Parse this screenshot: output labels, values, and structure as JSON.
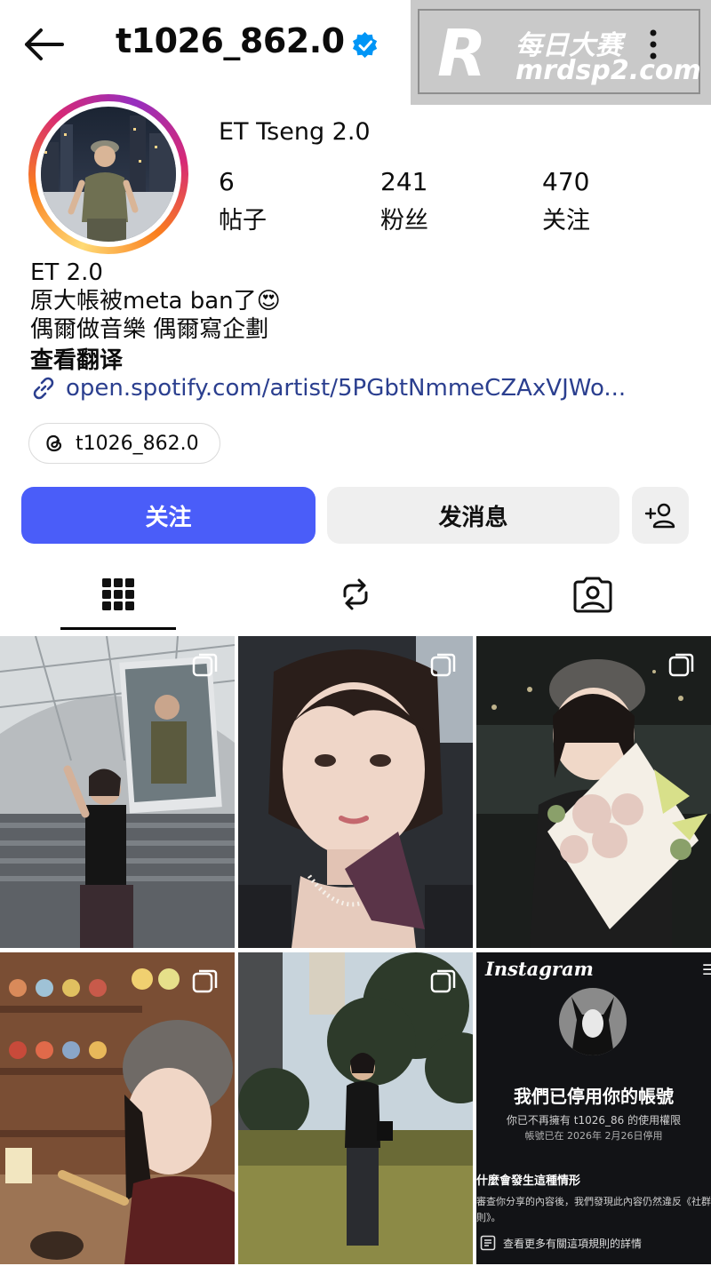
{
  "header": {
    "username": "t1026_862.0",
    "verified_icon": "verified-badge-icon",
    "back_icon": "arrow-left-icon",
    "more_icon": "more-vertical-icon"
  },
  "watermark": {
    "logo_letter": "R",
    "cn": "每日大赛",
    "en": "mrdsp2.com"
  },
  "profile": {
    "display_name": "ET Tseng 2.0",
    "stats": [
      {
        "count": "6",
        "label": "帖子"
      },
      {
        "count": "241",
        "label": "粉丝"
      },
      {
        "count": "470",
        "label": "关注"
      }
    ],
    "bio": [
      "ET 2.0",
      "原大帳被meta ban了😍",
      "偶爾做音樂 偶爾寫企劃"
    ],
    "translate_label": "查看翻译",
    "link": "open.spotify.com/artist/5PGbtNmmeCZAxVJWo...",
    "threads_handle": "t1026_862.0"
  },
  "actions": {
    "follow": "关注",
    "message": "发消息",
    "add_user_icon": "add-user-icon"
  },
  "tabs": [
    {
      "name": "posts",
      "icon": "grid-icon",
      "active": true
    },
    {
      "name": "reels",
      "icon": "reels-repost-icon",
      "active": false
    },
    {
      "name": "tagged",
      "icon": "tagged-person-icon",
      "active": false
    }
  ],
  "posts": [
    {
      "type": "carousel",
      "desc": "concert-venue-collage"
    },
    {
      "type": "carousel",
      "desc": "car-selfie"
    },
    {
      "type": "carousel",
      "desc": "flowers-portrait"
    },
    {
      "type": "carousel",
      "desc": "restaurant-toys"
    },
    {
      "type": "carousel",
      "desc": "park-evening"
    },
    {
      "type": "screenshot",
      "app_name": "Instagram",
      "headline": "我們已停用你的帳號",
      "line1": "你已不再擁有 t1026_86 的使用權限",
      "line2": "帳號已在 2026年 2月26日停用",
      "section_title": "什麼會發生這種情形",
      "section_body1": "審查你分享的內容後，我們發現此內容仍然違反《社群",
      "section_body2": "則》。",
      "more_link": "查看更多有關這項規則的詳情"
    }
  ],
  "colors": {
    "accent": "#4a5df9",
    "link": "#2b3f8f",
    "verified": "#0095f6"
  }
}
